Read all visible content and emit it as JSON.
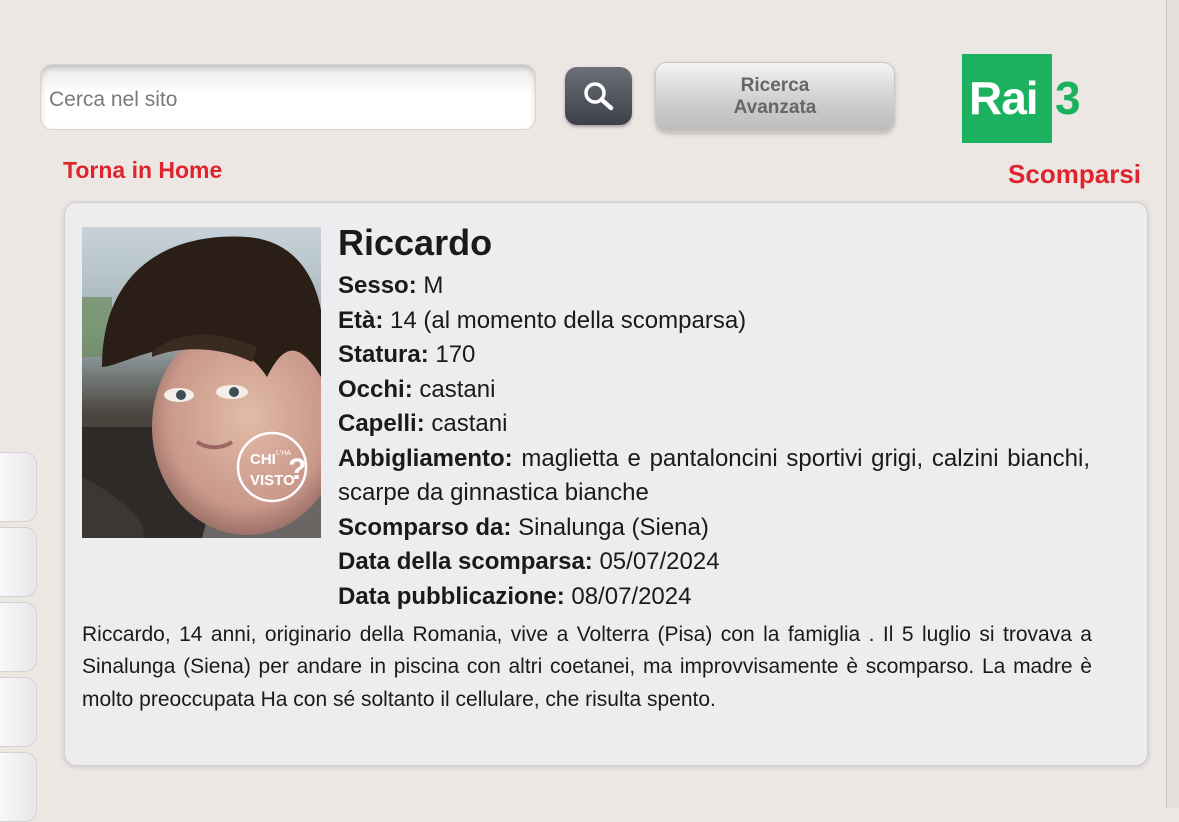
{
  "search": {
    "placeholder": "Cerca nel sito",
    "button_icon": "magnifier-icon",
    "advanced_label": "Ricerca Avanzata"
  },
  "brand": {
    "logo_word": "Rai",
    "logo_number": "3",
    "logo_color": "#1bb15f"
  },
  "nav": {
    "home_link": "Torna in Home",
    "section": "Scomparsi",
    "accent_color": "#e0242e"
  },
  "person": {
    "name": "Riccardo",
    "photo_watermark": "CHI L'HA VISTO?",
    "fields": [
      {
        "label": "Sesso:",
        "value": "M"
      },
      {
        "label": "Età:",
        "value": "14 (al momento della scomparsa)"
      },
      {
        "label": "Statura:",
        "value": "170"
      },
      {
        "label": "Occhi:",
        "value": "castani"
      },
      {
        "label": "Capelli:",
        "value": "castani"
      },
      {
        "label": "Abbigliamento:",
        "value": "maglietta e pantaloncini sportivi grigi, calzini bianchi, scarpe da ginnastica bianche"
      },
      {
        "label": "Scomparso da:",
        "value": "Sinalunga (Siena)"
      },
      {
        "label": "Data della scomparsa:",
        "value": "05/07/2024"
      },
      {
        "label": "Data pubblicazione:",
        "value": "08/07/2024"
      }
    ],
    "description": "Riccardo, 14 anni, originario della Romania, vive a Volterra (Pisa) con la famiglia . Il 5 luglio si trovava a Sinalunga (Siena) per andare in piscina con altri coetanei, ma improvvisamente è scomparso. La madre è molto preoccupata Ha con sé soltanto il cellulare, che risulta spento."
  }
}
